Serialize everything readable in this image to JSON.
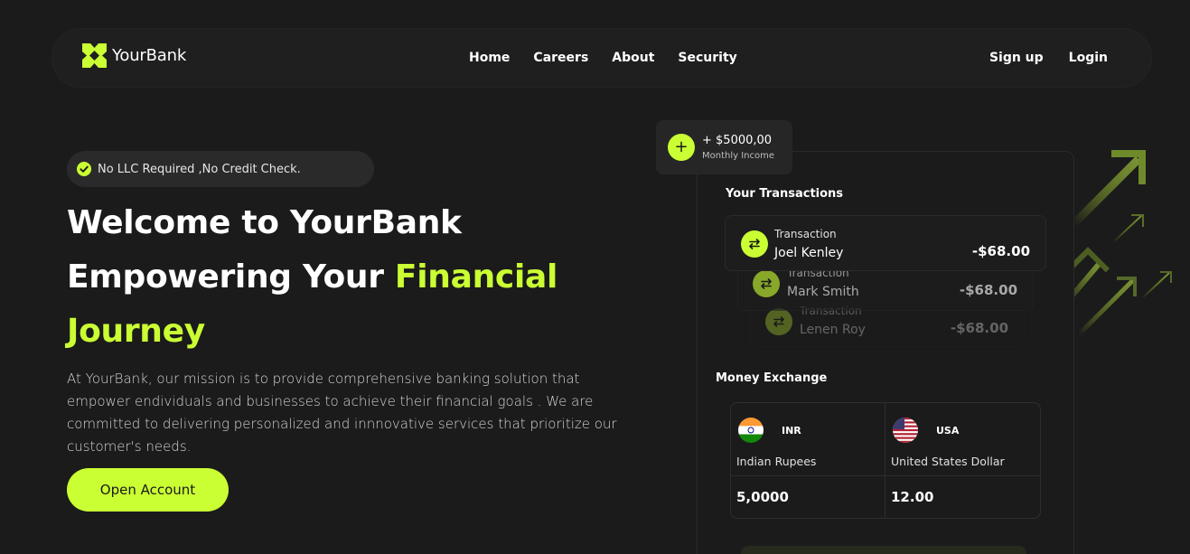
{
  "brand": {
    "name": "YourBank",
    "accent": "#caff33",
    "background": "#1b1b1b"
  },
  "nav": {
    "links": [
      "Home",
      "Careers",
      "About",
      "Security"
    ],
    "signup": "Sign up",
    "login": "Login"
  },
  "hero": {
    "badge": "No LLC Required ,No Credit Check.",
    "title_line1": "Welcome to YourBank",
    "title_line2_prefix": "Empowering Your ",
    "title_line2_highlight": "Financial",
    "title_line3": "Journey",
    "description": "At YourBank, our mission is to provide comprehensive banking solution that empower endividuals and businesses to achieve their financial goals . We are committed to delivering personalized and innnovative services that prioritize our customer's needs.",
    "cta": "Open Account"
  },
  "income": {
    "amount": "+ $5000,00",
    "label": "Monthly Income",
    "icon": "plus-icon"
  },
  "transactions": {
    "title": "Your Transactions",
    "items": [
      {
        "label": "Transaction",
        "name": "Joel Kenley",
        "amount": "-$68.00",
        "icon": "swap-icon"
      },
      {
        "label": "Transaction",
        "name": "Mark Smith",
        "amount": "-$68.00",
        "icon": "swap-icon"
      },
      {
        "label": "Transaction",
        "name": "Lenen Roy",
        "amount": "-$68.00",
        "icon": "swap-icon"
      }
    ]
  },
  "exchange": {
    "title": "Money Exchange",
    "from": {
      "code": "INR",
      "name": "Indian Rupees",
      "amount": "5,0000",
      "flag": "india-flag-icon"
    },
    "to": {
      "code": "USA",
      "name": "United States Dollar",
      "amount": "12.00",
      "flag": "usa-flag-icon"
    }
  }
}
